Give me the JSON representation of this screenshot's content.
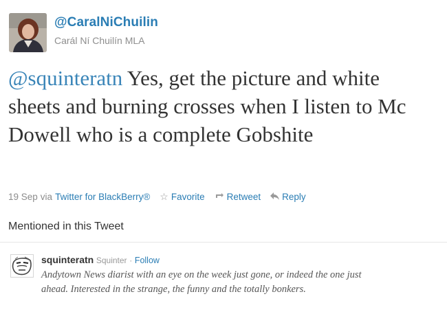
{
  "author": {
    "handle": "@CaralNiChuilin",
    "name": "Carál Ní Chuilín MLA",
    "avatar_icon": "profile-photo"
  },
  "tweet": {
    "mention": "@squinteratn",
    "text": " Yes, get the picture and white sheets and burning crosses when I listen to Mc Dowell who is a complete Gobshite"
  },
  "meta": {
    "date": "19 Sep",
    "via_prefix": "via",
    "client": "Twitter for BlackBerry®",
    "actions": {
      "favorite": "Favorite",
      "retweet": "Retweet",
      "reply": "Reply"
    }
  },
  "mentioned": {
    "title": "Mentioned in this Tweet",
    "user": {
      "username": "squinteratn",
      "realname": "Squinter",
      "separator": "·",
      "follow": "Follow",
      "bio": "Andytown News diarist with an eye on the week just gone, or indeed the one just ahead. Interested in the strange, the funny and the totally bonkers.",
      "avatar_icon": "sketch-avatar"
    }
  },
  "colors": {
    "link": "#2a7db4",
    "text": "#333333",
    "muted": "#8c8c8c"
  }
}
